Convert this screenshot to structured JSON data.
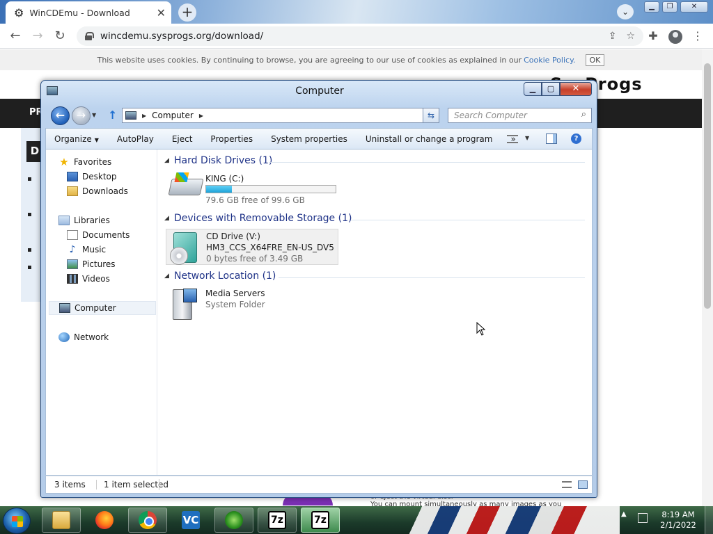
{
  "browser": {
    "tab_title": "WinCDEmu - Download",
    "tab_favicon": "gear-icon",
    "new_tab": "+",
    "url": "wincdemu.sysprogs.org/download/"
  },
  "webpage": {
    "cookie_text": "This website uses cookies. By continuing to browse, you are agreeing to our use of cookies as explained in our",
    "cookie_link": "Cookie Policy.",
    "cookie_ok": "OK",
    "logo": "SysProgs",
    "nav_partial": "PR",
    "d_box": "D",
    "bottom_text_1": "or eject the virtual disc.",
    "bottom_text_2": "You can mount simultaneously as many images as you"
  },
  "explorer": {
    "title": "Computer",
    "address_crumb": "Computer",
    "search_placeholder": "Search Computer",
    "commands": {
      "organize": "Organize",
      "autoplay": "AutoPlay",
      "eject": "Eject",
      "properties": "Properties",
      "system_properties": "System properties",
      "uninstall": "Uninstall or change a program",
      "more": "»"
    },
    "nav": {
      "favorites": "Favorites",
      "desktop": "Desktop",
      "downloads": "Downloads",
      "libraries": "Libraries",
      "documents": "Documents",
      "music": "Music",
      "pictures": "Pictures",
      "videos": "Videos",
      "computer": "Computer",
      "network": "Network"
    },
    "groups": {
      "hdd": "Hard Disk Drives (1)",
      "removable": "Devices with Removable Storage (1)",
      "network": "Network Location (1)"
    },
    "drive_c": {
      "name": "KING (C:)",
      "free_text": "79.6 GB free of 99.6 GB",
      "used_fraction": 0.2
    },
    "drive_v": {
      "name": "CD Drive (V:)",
      "label": "HM3_CCS_X64FRE_EN-US_DV5",
      "free_text": "0 bytes free of 3.49 GB"
    },
    "media": {
      "name": "Media Servers",
      "type": "System Folder"
    },
    "status": {
      "items": "3 items",
      "selected": "1 item selected"
    }
  },
  "taskbar": {
    "vc_label": "VC",
    "sz_label_1": "7z",
    "sz_label_2": "7z",
    "time": "8:19 AM",
    "date": "2/1/2022"
  }
}
